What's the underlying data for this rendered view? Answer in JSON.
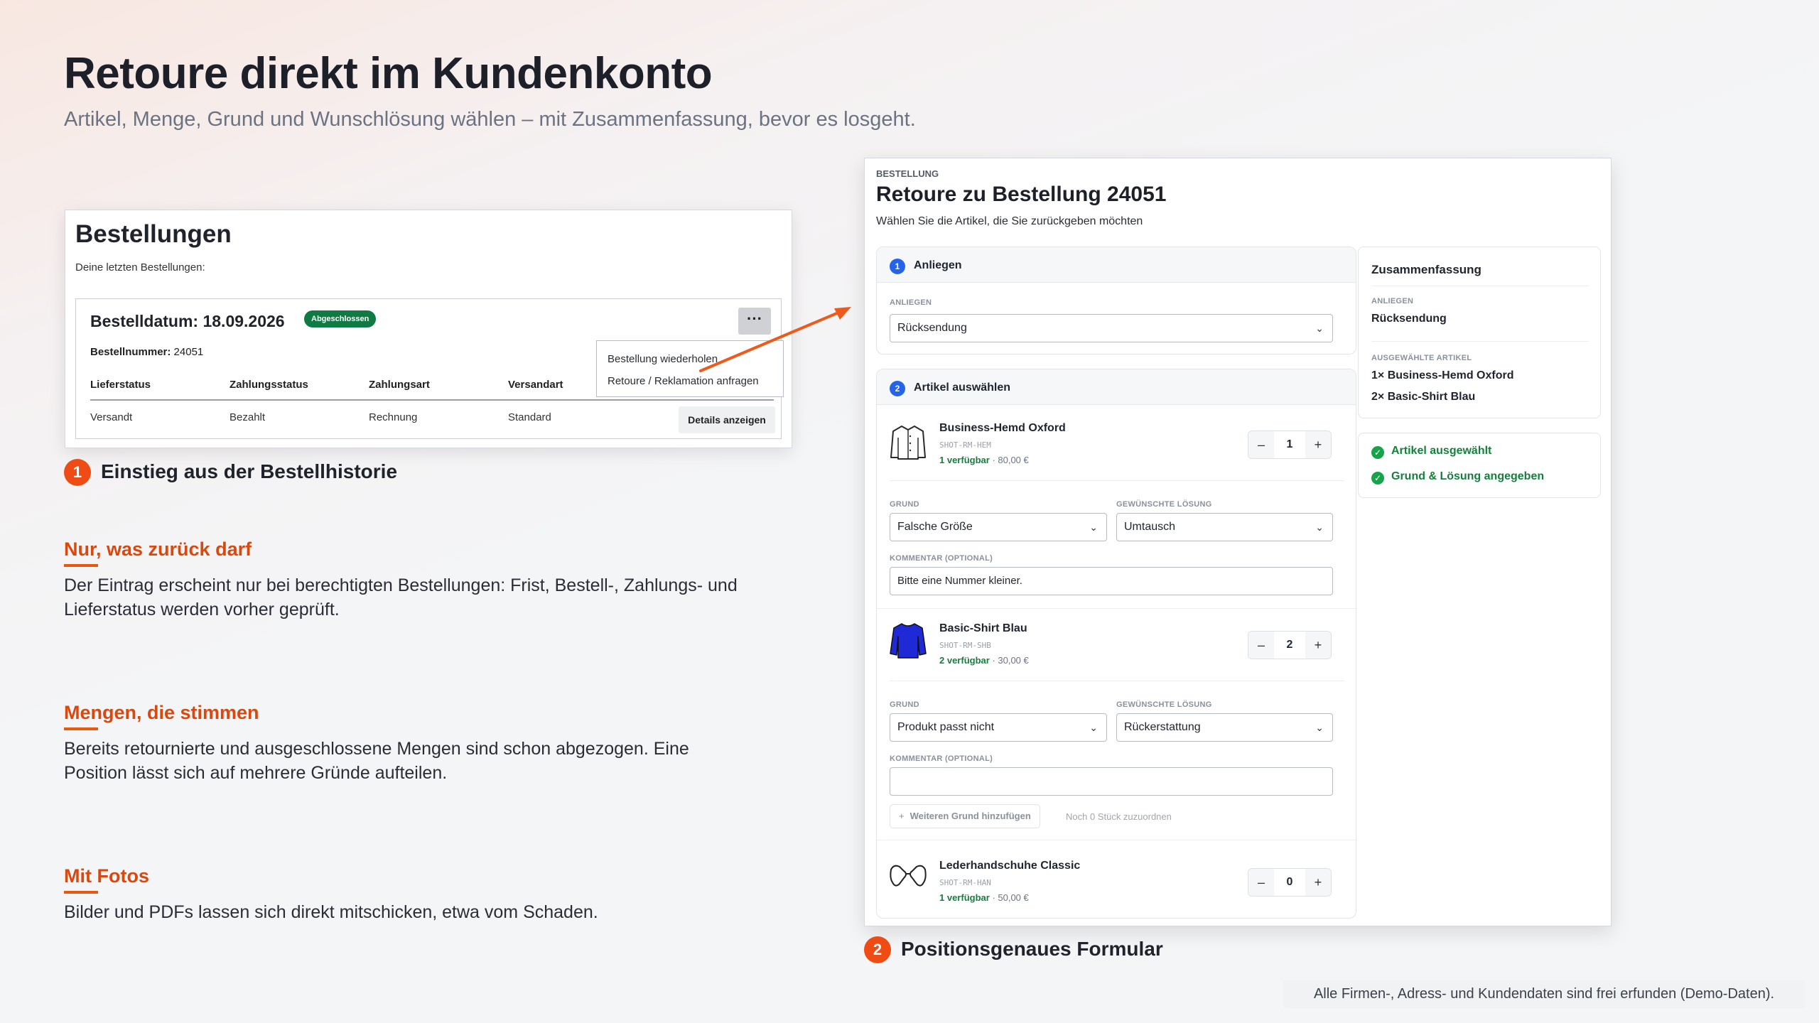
{
  "hero": {
    "title": "Retoure direkt im Kundenkonto",
    "subtitle": "Artikel, Menge, Grund und Wunschlösung wählen – mit Zusammenfassung, bevor es losgeht."
  },
  "orders_screenshot": {
    "title": "Bestellungen",
    "subtitle": "Deine letzten Bestellungen:",
    "order": {
      "date_label": "Bestelldatum: 18.09.2026",
      "status_badge": "Abgeschlossen",
      "number_label": "Bestellnummer:",
      "number_value": "24051",
      "columns": [
        "Lieferstatus",
        "Zahlungsstatus",
        "Zahlungsart",
        "Versandart"
      ],
      "values": [
        "Versandt",
        "Bezahlt",
        "Rechnung",
        "Standard"
      ],
      "menu_button": "···",
      "menu_items": [
        "Bestellung wiederholen",
        "Retoure / Reklamation anfragen"
      ],
      "details_button": "Details anzeigen"
    }
  },
  "steps": [
    {
      "number": "1",
      "label": "Einstieg aus der Bestellhistorie"
    },
    {
      "number": "2",
      "label": "Positionsgenaues Formular"
    }
  ],
  "features": [
    {
      "title": "Nur, was zurück darf",
      "body": "Der Eintrag erscheint nur bei berechtigten Bestellungen: Frist, Bestell-, Zahlungs- und Lieferstatus werden vorher geprüft."
    },
    {
      "title": "Mengen, die stimmen",
      "body": "Bereits retournierte und ausgeschlossene Mengen sind schon abgezogen. Eine Position lässt sich auf mehrere Gründe aufteilen."
    },
    {
      "title": "Mit Fotos",
      "body": "Bilder und PDFs lassen sich direkt mitschicken, etwa vom Schaden."
    }
  ],
  "form": {
    "overline": "BESTELLUNG",
    "title": "Retoure zu Bestellung 24051",
    "subtitle": "Wählen Sie die Artikel, die Sie zurückgeben möchten",
    "concern": {
      "step": "1",
      "title": "Anliegen",
      "field_label": "ANLIEGEN",
      "value": "Rücksendung"
    },
    "articles": {
      "step": "2",
      "title": "Artikel auswählen",
      "reason_label": "GRUND",
      "solution_label": "GEWÜNSCHTE LÖSUNG",
      "comment_label": "KOMMENTAR (OPTIONAL)",
      "items": [
        {
          "name": "Business-Hemd Oxford",
          "sku": "SHOT-RM-HEM",
          "available": "1 verfügbar",
          "price": "· 80,00 €",
          "qty": "1",
          "reason": "Falsche Größe",
          "solution": "Umtausch",
          "comment": "Bitte eine Nummer kleiner.",
          "icon": "shirt-jacket-icon",
          "color": "#ffffff"
        },
        {
          "name": "Basic-Shirt Blau",
          "sku": "SHOT-RM-SHB",
          "available": "2 verfügbar",
          "price": "· 30,00 €",
          "qty": "2",
          "reason": "Produkt passt nicht",
          "solution": "Rückerstattung",
          "comment": "",
          "icon": "shirt-icon",
          "color": "#1f2ad6"
        },
        {
          "name": "Lederhandschuhe Classic",
          "sku": "SHOT-RM-HAN",
          "available": "1 verfügbar",
          "price": "· 50,00 €",
          "qty": "0",
          "icon": "gloves-icon"
        }
      ],
      "add_reason_button": "Weiteren Grund hinzufügen",
      "add_reason_hint": "Noch 0 Stück zuzuordnen",
      "stepper_minus": "–",
      "stepper_plus": "+"
    },
    "summary": {
      "title": "Zusammenfassung",
      "concern_label": "ANLIEGEN",
      "concern_value": "Rücksendung",
      "selected_label": "AUSGEWÄHLTE ARTIKEL",
      "selected_items": [
        "1× Business-Hemd Oxford",
        "2× Basic-Shirt Blau"
      ]
    },
    "checklist": [
      "Artikel ausgewählt",
      "Grund & Lösung angegeben"
    ]
  },
  "footnote": "Alle Firmen-, Adress- und Kundendaten sind frei erfunden (Demo-Daten).",
  "colors": {
    "accent": "#e8580f",
    "feature_title": "#d9480f",
    "step_badge": "#ef4b14",
    "primary_blue": "#2563eb",
    "success": "#15803d",
    "status_badge": "#0f7a43"
  }
}
